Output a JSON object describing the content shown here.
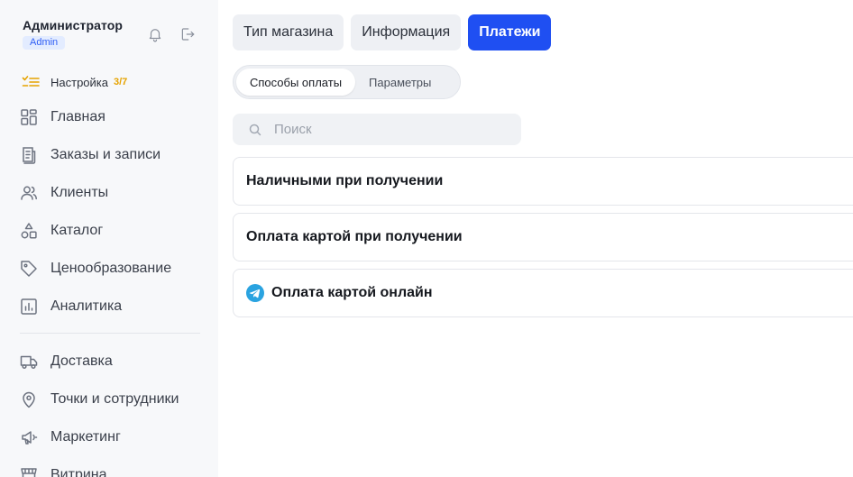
{
  "user": {
    "name": "Администратор",
    "role": "Admin"
  },
  "setup": {
    "label": "Настройка",
    "count": "3/7"
  },
  "nav": {
    "items": [
      {
        "label": "Главная",
        "icon": "grid-icon"
      },
      {
        "label": "Заказы и записи",
        "icon": "receipt-icon"
      },
      {
        "label": "Клиенты",
        "icon": "users-icon"
      },
      {
        "label": "Каталог",
        "icon": "catalog-shapes-icon"
      },
      {
        "label": "Ценообразование",
        "icon": "price-tag-icon"
      },
      {
        "label": "Аналитика",
        "icon": "chart-icon"
      },
      {
        "label": "Доставка",
        "icon": "truck-icon"
      },
      {
        "label": "Точки и сотрудники",
        "icon": "map-pin-icon"
      },
      {
        "label": "Маркетинг",
        "icon": "megaphone-icon"
      },
      {
        "label": "Витрина",
        "icon": "storefront-icon"
      }
    ]
  },
  "tabs": [
    {
      "label": "Тип магазина",
      "active": false
    },
    {
      "label": "Информация",
      "active": false
    },
    {
      "label": "Платежи",
      "active": true
    }
  ],
  "subtabs": [
    {
      "label": "Способы оплаты",
      "active": true
    },
    {
      "label": "Параметры",
      "active": false
    }
  ],
  "search": {
    "placeholder": "Поиск"
  },
  "payment_methods": [
    {
      "label": "Наличными при получении"
    },
    {
      "label": "Оплата картой при получении"
    },
    {
      "label": "Оплата картой онлайн",
      "icon": "telegram-icon"
    }
  ],
  "colors": {
    "accent": "#1f4ff2",
    "setup_accent": "#e6a300",
    "telegram": "#2aa3e0"
  }
}
